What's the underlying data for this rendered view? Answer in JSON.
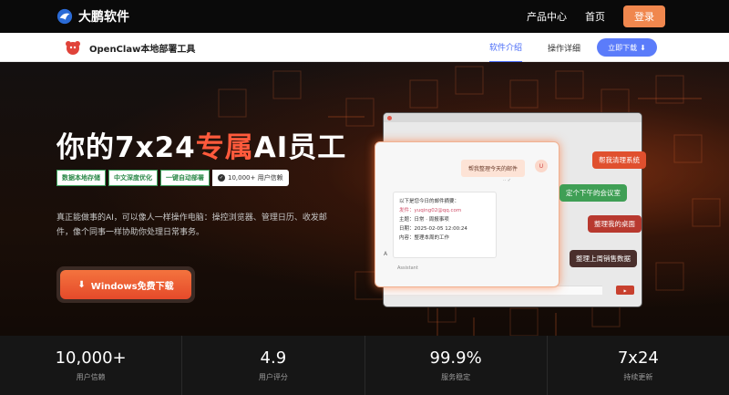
{
  "topbar": {
    "brand": "大鹏软件",
    "nav": [
      "产品中心",
      "首页"
    ],
    "login": "登录"
  },
  "subbar": {
    "product_name": "OpenClaw本地部署工具",
    "nav": [
      "软件介绍",
      "操作详细"
    ],
    "download": "立即下载"
  },
  "hero": {
    "headline_pre": "你的7x24",
    "headline_accent": "专属",
    "headline_post": "AI员工",
    "tags": [
      "数据本地存储",
      "中文深度优化",
      "一键自动部署"
    ],
    "users_tag": "10,000+ 用户信赖",
    "description": "真正能做事的AI，可以像人一样操作电脑：操控浏览器、管理日历、收发邮件，像个同事一样协助你处理日常事务。",
    "download_button": "Windows免费下载"
  },
  "app_preview": {
    "user_message": "帮我整理今天的邮件",
    "user_avatar": "U",
    "ai_lines": [
      "以下是您今日的邮件摘要：",
      "发件：yuqing02@qq.com",
      "主题：日常 · 周报事项",
      "日期：2025-02-05 12:00:24",
      "内容：整理本周的工作"
    ],
    "ai_footer": "Assistant",
    "ai_avatar": "A"
  },
  "chips": [
    {
      "label": "帮我清理系统",
      "color": "#e0502e"
    },
    {
      "label": "定个下午的会议室",
      "color": "#3f9f55"
    },
    {
      "label": "整理我的桌面",
      "color": "#b8392f"
    },
    {
      "label": "整理上周销售数据",
      "color": "#4a2f2c"
    }
  ],
  "stats": [
    {
      "value": "10,000+",
      "label": "用户信赖"
    },
    {
      "value": "4.9",
      "label": "用户评分"
    },
    {
      "value": "99.9%",
      "label": "服务稳定"
    },
    {
      "value": "7x24",
      "label": "持续更新"
    }
  ]
}
